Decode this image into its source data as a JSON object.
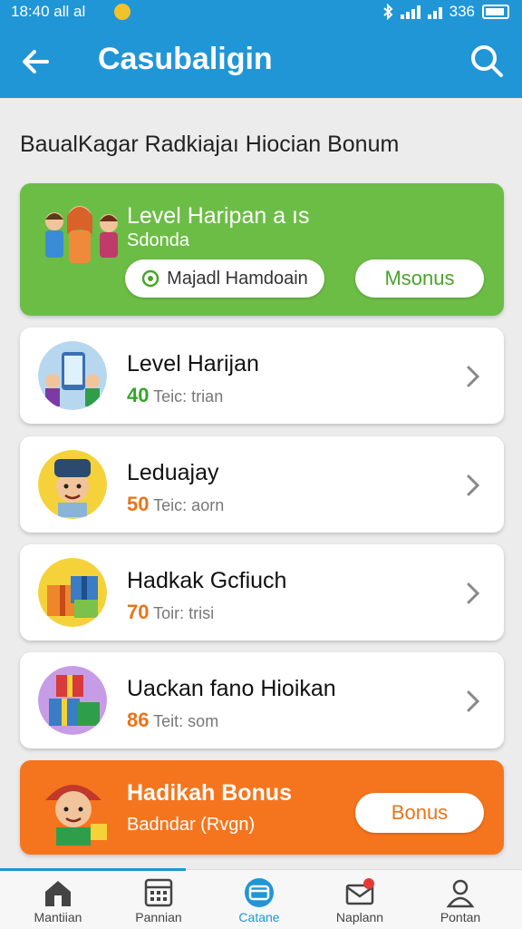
{
  "status_bar": {
    "time": "18:40 all al",
    "battery_text": "336"
  },
  "header": {
    "title": "Casubaligin"
  },
  "subtitle": "BaualKagar Radkiajaı Hiocian Bonum",
  "featured": {
    "title": "Level Haripan a ıs",
    "subtitle": "Sdonda",
    "button1": "Majadl Hamdoain",
    "button2": "Msonus"
  },
  "list": [
    {
      "title": "Level Harijan",
      "points": "40",
      "points_color": "#35a52a",
      "meta": "Teic: trian",
      "icon": "phone-people-icon"
    },
    {
      "title": "Leduajay",
      "points": "50",
      "points_color": "#e8741a",
      "meta": "Teic: aorn",
      "icon": "boy-character-icon"
    },
    {
      "title": "Hadkak Gcfiuch",
      "points": "70",
      "points_color": "#e8741a",
      "meta": "Toir: trisi",
      "icon": "gift-boxes-icon"
    },
    {
      "title": "Uackan fano Hioikan",
      "points": "86",
      "points_color": "#e8741a",
      "meta": "Teit: som",
      "icon": "gift-stack-icon"
    }
  ],
  "bonus_card": {
    "title": "Hadikah Bonus",
    "subtitle": "Badndar (Rvgn)",
    "button": "Bonus"
  },
  "bottom_nav": [
    {
      "label": "Mantiian",
      "icon": "home-icon"
    },
    {
      "label": "Pannian",
      "icon": "calendar-icon"
    },
    {
      "label": "Catane",
      "icon": "wallet-icon"
    },
    {
      "label": "Naplann",
      "icon": "mail-icon"
    },
    {
      "label": "Pontan",
      "icon": "profile-icon"
    }
  ],
  "colors": {
    "primary": "#2196d6",
    "green": "#6cbd45",
    "orange": "#f5751e"
  }
}
